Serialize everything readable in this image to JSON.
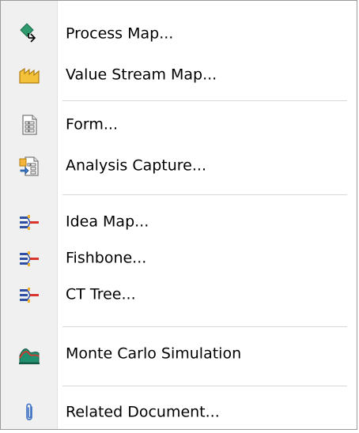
{
  "menu": {
    "items": [
      {
        "label": "Process Map...",
        "icon": "process-map-icon"
      },
      {
        "label": "Value Stream Map...",
        "icon": "value-stream-map-icon"
      },
      {
        "label": "Form...",
        "icon": "form-icon"
      },
      {
        "label": "Analysis Capture...",
        "icon": "analysis-capture-icon"
      },
      {
        "label": "Idea Map...",
        "icon": "idea-map-icon"
      },
      {
        "label": "Fishbone...",
        "icon": "fishbone-icon"
      },
      {
        "label": "CT Tree...",
        "icon": "ct-tree-icon"
      },
      {
        "label": "Monte Carlo Simulation",
        "icon": "monte-carlo-icon"
      },
      {
        "label": "Related Document...",
        "icon": "paperclip-icon"
      }
    ]
  }
}
